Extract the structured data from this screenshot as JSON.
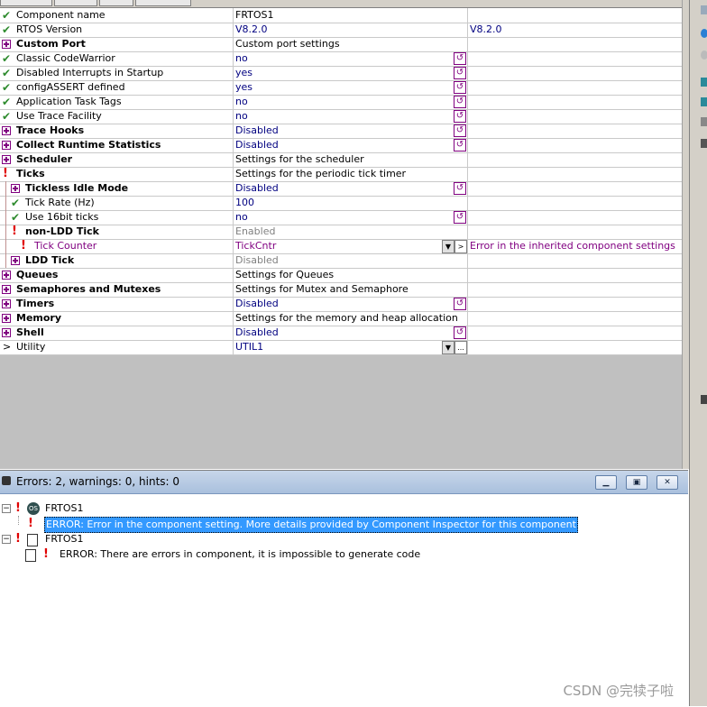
{
  "inspector": {
    "rows": [
      {
        "icon": "check",
        "indent": 0,
        "bold": false,
        "name": "Component name",
        "value": "FRTOS1",
        "extra": "",
        "reset": false,
        "value_style": "black"
      },
      {
        "icon": "check",
        "indent": 0,
        "bold": false,
        "name": "RTOS Version",
        "value": "V8.2.0",
        "extra": "V8.2.0",
        "reset": false,
        "value_style": "navy"
      },
      {
        "icon": "plus",
        "indent": 0,
        "bold": true,
        "name": "Custom Port",
        "value": "Custom port settings",
        "extra": "",
        "reset": false,
        "value_style": "black"
      },
      {
        "icon": "check",
        "indent": 0,
        "bold": false,
        "name": "Classic CodeWarrior",
        "value": "no",
        "extra": "",
        "reset": true,
        "value_style": "navy"
      },
      {
        "icon": "check",
        "indent": 0,
        "bold": false,
        "name": "Disabled Interrupts in Startup",
        "value": "yes",
        "extra": "",
        "reset": true,
        "value_style": "navy"
      },
      {
        "icon": "check",
        "indent": 0,
        "bold": false,
        "name": "configASSERT defined",
        "value": "yes",
        "extra": "",
        "reset": true,
        "value_style": "navy"
      },
      {
        "icon": "check",
        "indent": 0,
        "bold": false,
        "name": "Application Task Tags",
        "value": "no",
        "extra": "",
        "reset": true,
        "value_style": "navy"
      },
      {
        "icon": "check",
        "indent": 0,
        "bold": false,
        "name": "Use Trace Facility",
        "value": "no",
        "extra": "",
        "reset": true,
        "value_style": "navy"
      },
      {
        "icon": "plus",
        "indent": 0,
        "bold": true,
        "name": "Trace Hooks",
        "value": "Disabled",
        "extra": "",
        "reset": true,
        "value_style": "navy"
      },
      {
        "icon": "plus",
        "indent": 0,
        "bold": true,
        "name": "Collect Runtime Statistics",
        "value": "Disabled",
        "extra": "",
        "reset": true,
        "value_style": "navy"
      },
      {
        "icon": "plus",
        "indent": 0,
        "bold": true,
        "name": "Scheduler",
        "value": "Settings for the scheduler",
        "extra": "",
        "reset": false,
        "value_style": "black"
      },
      {
        "icon": "err",
        "indent": 0,
        "bold": true,
        "name": "Ticks",
        "value": "Settings for the periodic tick timer",
        "extra": "",
        "reset": false,
        "value_style": "black"
      },
      {
        "icon": "plus",
        "indent": 1,
        "bold": true,
        "name": "Tickless Idle Mode",
        "value": "Disabled",
        "extra": "",
        "reset": true,
        "value_style": "navy"
      },
      {
        "icon": "check",
        "indent": 1,
        "bold": false,
        "name": "Tick Rate (Hz)",
        "value": "100",
        "extra": "",
        "reset": false,
        "value_style": "navy"
      },
      {
        "icon": "check",
        "indent": 1,
        "bold": false,
        "name": "Use 16bit ticks",
        "value": "no",
        "extra": "",
        "reset": true,
        "value_style": "navy"
      },
      {
        "icon": "err",
        "indent": 1,
        "bold": true,
        "name": "non-LDD Tick",
        "value": "Enabled",
        "extra": "",
        "reset": false,
        "value_style": "grey"
      },
      {
        "icon": "err",
        "indent": 2,
        "bold": false,
        "name": "Tick Counter",
        "value": "TickCntr",
        "extra": "Error in the inherited component settings",
        "reset": false,
        "value_style": "purple",
        "name_style": "purple",
        "dropdown": true,
        "link": true
      },
      {
        "icon": "plus",
        "indent": 1,
        "bold": true,
        "name": "LDD Tick",
        "value": "Disabled",
        "extra": "",
        "reset": false,
        "value_style": "grey"
      },
      {
        "icon": "plus",
        "indent": 0,
        "bold": true,
        "name": "Queues",
        "value": "Settings for Queues",
        "extra": "",
        "reset": false,
        "value_style": "black"
      },
      {
        "icon": "plus",
        "indent": 0,
        "bold": true,
        "name": "Semaphores and Mutexes",
        "value": "Settings for Mutex and Semaphore",
        "extra": "",
        "reset": false,
        "value_style": "black"
      },
      {
        "icon": "plus",
        "indent": 0,
        "bold": true,
        "name": "Timers",
        "value": "Disabled",
        "extra": "",
        "reset": true,
        "value_style": "navy"
      },
      {
        "icon": "plus",
        "indent": 0,
        "bold": true,
        "name": "Memory",
        "value": "Settings for the memory and heap allocation",
        "extra": "",
        "reset": false,
        "value_style": "black"
      },
      {
        "icon": "plus",
        "indent": 0,
        "bold": true,
        "name": "Shell",
        "value": "Disabled",
        "extra": "",
        "reset": true,
        "value_style": "navy"
      },
      {
        "icon": "arrow",
        "indent": 0,
        "bold": false,
        "name": "Utility",
        "value": "UTIL1",
        "extra": "",
        "reset": false,
        "value_style": "navy",
        "dropdown": true,
        "ellipsis": true
      }
    ]
  },
  "errors": {
    "title": "Errors: 2, warnings: 0, hints: 0",
    "items": [
      {
        "kind": "component",
        "label": "FRTOS1",
        "icon": "os-icon"
      },
      {
        "kind": "message",
        "label": "ERROR: Error in the component setting. More details provided by Component Inspector for this component",
        "selected": true
      },
      {
        "kind": "component",
        "label": "FRTOS1",
        "icon": "generator-icon"
      },
      {
        "kind": "message",
        "label": "ERROR: There are errors in component, it is impossible to generate code",
        "selected": false
      }
    ]
  },
  "watermark": "CSDN @完犊子啦"
}
